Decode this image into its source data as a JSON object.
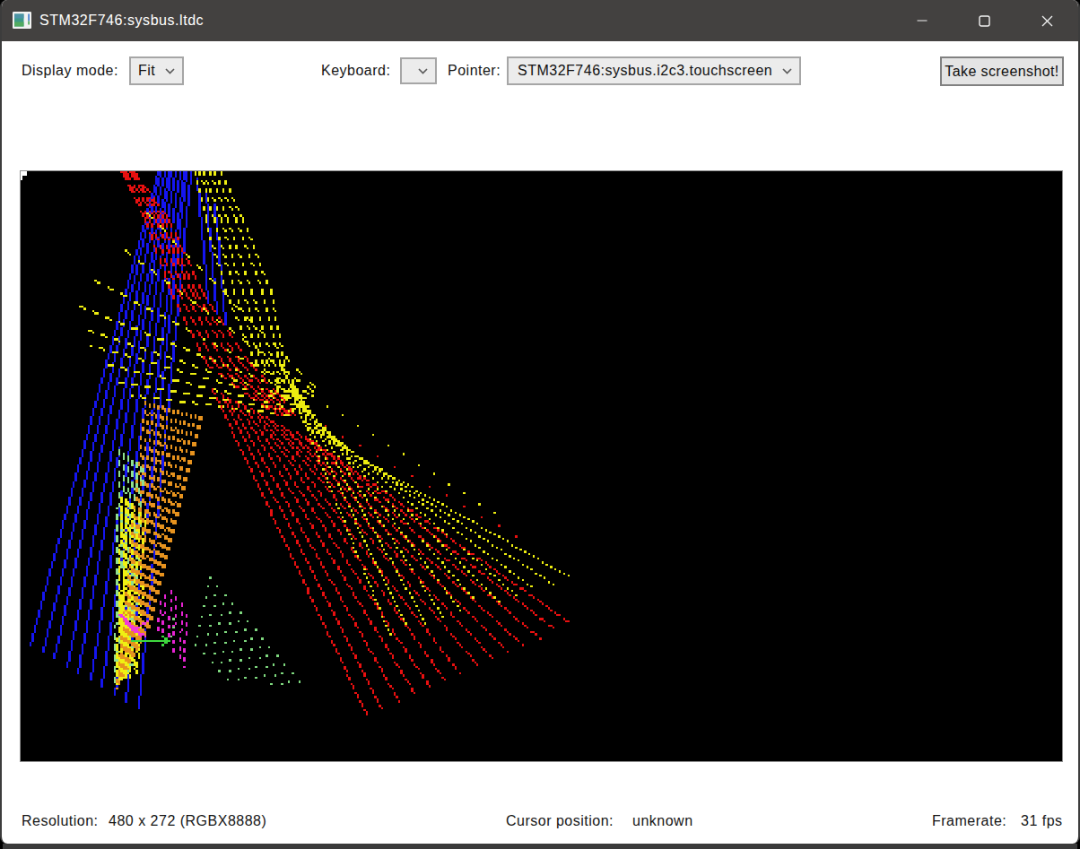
{
  "window": {
    "title": "STM32F746:sysbus.ltdc",
    "controls": {
      "minimize": "minimize",
      "maximize": "maximize",
      "close": "close"
    }
  },
  "toolbar": {
    "display_mode_label": "Display mode:",
    "display_mode_value": "Fit",
    "keyboard_label": "Keyboard:",
    "keyboard_value": "",
    "pointer_label": "Pointer:",
    "pointer_value": "STM32F746:sysbus.i2c3.touchscreen",
    "screenshot_button": "Take screenshot!"
  },
  "status_bar": {
    "resolution_label": "Resolution:",
    "resolution_value": "480 x 272 (RGBX8888)",
    "cursor_label": "Cursor position:",
    "cursor_value": "unknown",
    "framerate_label": "Framerate:",
    "framerate_value": "31 fps"
  },
  "colors": {
    "titlebar": "#434140",
    "titlebar_text": "#ffffff",
    "body": "#ffffff",
    "combo_fill": "#ececec",
    "combo_border": "#a6a6a6",
    "button_fill": "#e4e4e4",
    "button_border": "#818181",
    "framebuffer_border": "#8e8e8e",
    "outside": "#000000",
    "bottom_strip": "#3a3a3a"
  },
  "framebuffer": {
    "logical_width": 480,
    "logical_height": 272,
    "background": "#000000",
    "groups": [
      {
        "name": "blue-fan",
        "color": "#1515f0",
        "dash": [
          1,
          0
        ],
        "lines": [
          [
            62.5,
            0.0,
            4.0,
            218.0
          ],
          [
            64.2,
            0.0,
            9.6,
            221.2
          ],
          [
            65.9,
            0.0,
            15.1,
            224.4
          ],
          [
            67.7,
            0.0,
            20.7,
            227.7
          ],
          [
            69.4,
            0.0,
            26.2,
            230.9
          ],
          [
            71.1,
            0.0,
            31.8,
            234.1
          ],
          [
            72.8,
            0.0,
            37.3,
            237.3
          ],
          [
            74.6,
            0.0,
            42.9,
            240.6
          ],
          [
            76.3,
            0.0,
            48.4,
            243.8
          ],
          [
            78.0,
            0.0,
            54.0,
            247.0
          ],
          [
            80.5,
            3,
            85.5,
            60
          ],
          [
            84.5,
            9,
            89.5,
            65
          ],
          [
            88.5,
            15,
            93.5,
            70
          ]
        ]
      },
      {
        "name": "pale-green-column",
        "color": "#8fe08f",
        "dash": [
          3,
          2
        ],
        "lines": [
          [
            45.0,
            128.0,
            43.0,
            236.0
          ],
          [
            46.9,
            129.5,
            44.4,
            234.5
          ],
          [
            48.8,
            131.0,
            45.8,
            233.0
          ],
          [
            50.7,
            132.5,
            47.2,
            231.5
          ],
          [
            52.6,
            134.0,
            48.6,
            230.0
          ],
          [
            54.5,
            135.5,
            50.0,
            228.5
          ],
          [
            56.4,
            137.0,
            51.4,
            227.0
          ]
        ]
      },
      {
        "name": "bright-yellow-column",
        "color": "#f0f012",
        "dash": [
          3,
          1
        ],
        "lines": [
          [
            46.0,
            150.0,
            44.0,
            236.0
          ],
          [
            47.6,
            151.0,
            45.1,
            235.0
          ],
          [
            49.1,
            152.0,
            46.1,
            234.0
          ],
          [
            50.7,
            153.0,
            47.2,
            233.0
          ],
          [
            52.3,
            154.0,
            48.3,
            232.0
          ],
          [
            53.9,
            155.0,
            49.4,
            231.0
          ],
          [
            55.4,
            156.0,
            50.4,
            230.0
          ],
          [
            57.0,
            157.0,
            51.5,
            229.0
          ],
          [
            47.0,
            185.0,
            45.0,
            236.0
          ],
          [
            50.0,
            186.7,
            47.5,
            234.3
          ],
          [
            53.0,
            188.3,
            50.0,
            232.7
          ],
          [
            56.0,
            190.0,
            52.5,
            231.0
          ]
        ]
      },
      {
        "name": "orange-column",
        "color": "#e6921e",
        "dash": [
          2,
          2
        ],
        "lines": [
          [
            57.0,
            106.0,
            44.0,
            238.0
          ],
          [
            58.9,
            106.5,
            45.0,
            236.1
          ],
          [
            60.8,
            107.0,
            46.0,
            234.2
          ],
          [
            62.7,
            107.5,
            47.0,
            232.3
          ],
          [
            64.5,
            108.1,
            47.9,
            230.5
          ],
          [
            66.4,
            108.6,
            48.9,
            228.6
          ],
          [
            68.3,
            109.1,
            49.9,
            226.7
          ],
          [
            70.2,
            109.6,
            50.9,
            224.8
          ],
          [
            72.1,
            110.1,
            51.9,
            222.9
          ],
          [
            74.0,
            110.6,
            52.9,
            221.0
          ],
          [
            75.9,
            111.1,
            53.9,
            219.1
          ],
          [
            77.7,
            111.7,
            54.8,
            217.3
          ],
          [
            79.6,
            112.2,
            55.8,
            215.4
          ],
          [
            81.5,
            112.7,
            56.8,
            213.5
          ],
          [
            83.4,
            113.2,
            57.8,
            211.6
          ]
        ]
      },
      {
        "name": "green-dot-fan",
        "color": "#7ed87e",
        "dash": [
          1,
          3
        ],
        "lines": [
          [
            80.0,
            218.0,
            97.0,
            236.0
          ],
          [
            81.0,
            213.6,
            101.6,
            236.0
          ],
          [
            82.0,
            209.1,
            106.1,
            236.0
          ],
          [
            83.0,
            204.7,
            110.7,
            236.0
          ],
          [
            84.0,
            200.3,
            115.3,
            236.0
          ],
          [
            85.0,
            195.9,
            119.9,
            236.0
          ],
          [
            86.0,
            191.4,
            124.4,
            236.0
          ],
          [
            87.0,
            187.0,
            129.0,
            236.0
          ],
          [
            69.5,
            206,
            68.8,
            215
          ]
        ]
      },
      {
        "name": "green-arrow",
        "color": "#3ed83e",
        "dash": [
          1,
          0
        ],
        "lines": [
          [
            51,
            216,
            67.5,
            216
          ],
          [
            64.5,
            213.8,
            67.5,
            216
          ],
          [
            64.5,
            218.2,
            67.5,
            216
          ]
        ]
      },
      {
        "name": "magenta-dashes",
        "color": "#e622d2",
        "dash": [
          2,
          2
        ],
        "lines": [
          [
            63.5,
            198,
            62.5,
            211
          ],
          [
            66,
            195,
            65,
            212
          ],
          [
            68.5,
            193,
            67.5,
            216
          ],
          [
            71,
            196,
            70,
            221
          ],
          [
            73.5,
            199,
            72.5,
            225
          ],
          [
            76,
            204,
            75,
            228
          ]
        ]
      },
      {
        "name": "magenta-knot",
        "color": "#f03ad8",
        "dash": [
          1,
          0
        ],
        "lines": [
          [
            44.5,
            204,
            51.5,
            210.5
          ],
          [
            45.5,
            204,
            52.5,
            210.5
          ],
          [
            51.5,
            210.5,
            58,
            207
          ],
          [
            51.5,
            210.5,
            57,
            213.5
          ],
          [
            48,
            208,
            53.5,
            212.5
          ],
          [
            49,
            209,
            54.5,
            213.5
          ]
        ]
      },
      {
        "name": "yellow-band",
        "color": "#ecec10",
        "dash": [
          2,
          2
        ],
        "lines": [
          [
            79.5,
            0,
            85.0,
            22
          ],
          [
            85.0,
            22,
            93.7,
            55
          ],
          [
            93.7,
            55,
            107.9,
            88
          ],
          [
            107.9,
            88,
            120.4,
            103
          ],
          [
            120.4,
            103,
            127.6,
            110
          ],
          [
            81.9,
            0,
            88.5,
            22
          ],
          [
            88.5,
            22,
            97.9,
            55
          ],
          [
            97.9,
            55,
            110.5,
            88
          ],
          [
            110.5,
            88,
            121.8,
            103
          ],
          [
            121.8,
            103,
            128.6,
            110
          ],
          [
            84.3,
            0,
            92.0,
            22
          ],
          [
            92.0,
            22,
            102.1,
            55
          ],
          [
            102.1,
            55,
            113.2,
            88
          ],
          [
            113.2,
            88,
            123.3,
            103
          ],
          [
            123.3,
            103,
            129.5,
            110
          ],
          [
            86.7,
            0,
            95.4,
            22
          ],
          [
            95.4,
            22,
            106.3,
            55
          ],
          [
            106.3,
            55,
            115.8,
            88
          ],
          [
            115.8,
            88,
            124.7,
            103
          ],
          [
            124.7,
            103,
            130.5,
            110
          ],
          [
            89.1,
            0,
            98.9,
            22
          ],
          [
            98.9,
            22,
            110.5,
            55
          ],
          [
            110.5,
            55,
            118.5,
            88
          ],
          [
            118.5,
            88,
            126.2,
            103
          ],
          [
            126.2,
            103,
            131.4,
            110
          ],
          [
            91.5,
            0,
            102.4,
            22
          ],
          [
            102.4,
            22,
            114.7,
            55
          ],
          [
            114.7,
            55,
            121.1,
            88
          ],
          [
            121.1,
            88,
            127.6,
            103
          ],
          [
            127.6,
            103,
            132.4,
            110
          ]
        ]
      },
      {
        "name": "yellow-left-fan",
        "color": "#ecec10",
        "dash": [
          3,
          3
        ],
        "lines": [
          [
            135.0,
            99.0,
            57,
            18
          ],
          [
            133.5,
            100.6,
            45,
            34
          ],
          [
            132.0,
            102.2,
            34,
            50
          ],
          [
            130.5,
            103.9,
            27,
            62
          ],
          [
            129.0,
            105.5,
            28,
            72
          ],
          [
            127.5,
            107.1,
            32,
            80
          ],
          [
            126.0,
            108.8,
            37,
            88
          ],
          [
            124.5,
            110.4,
            44,
            97
          ],
          [
            123.0,
            112.0,
            51,
            103
          ]
        ]
      },
      {
        "name": "yellow-right-fan",
        "color": "#ecec10",
        "dash": [
          1,
          1
        ],
        "lines": [
          [
            118.0,
            85.0,
            170.0,
            214.0
          ],
          [
            119.4,
            88.3,
            178.3,
            211.3
          ],
          [
            120.8,
            91.6,
            186.6,
            208.6
          ],
          [
            122.2,
            94.9,
            194.9,
            205.9
          ],
          [
            123.6,
            98.2,
            203.2,
            203.2
          ],
          [
            125.0,
            101.5,
            211.5,
            200.5
          ],
          [
            126.4,
            104.8,
            219.8,
            197.8
          ],
          [
            127.8,
            108.1,
            228.1,
            195.1
          ],
          [
            129.2,
            111.4,
            236.4,
            192.4
          ],
          [
            130.6,
            114.7,
            244.7,
            189.7
          ],
          [
            132.0,
            118.0,
            253.0,
            187.0
          ]
        ]
      },
      {
        "name": "yellow-sparse",
        "color": "#ecec10",
        "dash": [
          1,
          6
        ],
        "lines": [
          [
            134,
            103,
            218,
            157
          ]
        ]
      },
      {
        "name": "red-band",
        "color": "#e81010",
        "dash": [
          4,
          2
        ],
        "lines": [
          [
            45.8,
            0,
            57.0,
            22
          ],
          [
            57.0,
            22,
            69.1,
            55
          ],
          [
            69.1,
            55,
            85.0,
            88
          ],
          [
            85.0,
            88,
            104.8,
            103
          ],
          [
            104.8,
            103,
            118.0,
            112
          ],
          [
            47.1,
            0,
            59.2,
            22
          ],
          [
            59.2,
            22,
            71.9,
            55
          ],
          [
            71.9,
            55,
            89.0,
            88
          ],
          [
            89.0,
            88,
            107.7,
            103
          ],
          [
            107.7,
            103,
            119.6,
            112
          ],
          [
            48.4,
            0,
            61.5,
            22
          ],
          [
            61.5,
            22,
            74.7,
            55
          ],
          [
            74.7,
            55,
            93.0,
            88
          ],
          [
            93.0,
            88,
            110.6,
            103
          ],
          [
            110.6,
            103,
            121.2,
            112
          ],
          [
            49.6,
            0,
            63.7,
            22
          ],
          [
            63.7,
            22,
            77.5,
            55
          ],
          [
            77.5,
            55,
            97.0,
            88
          ],
          [
            97.0,
            88,
            113.4,
            103
          ],
          [
            113.4,
            103,
            122.8,
            112
          ],
          [
            50.9,
            0,
            66.0,
            22
          ],
          [
            66.0,
            22,
            80.3,
            55
          ],
          [
            80.3,
            55,
            101.0,
            88
          ],
          [
            101.0,
            88,
            116.3,
            103
          ],
          [
            116.3,
            103,
            124.4,
            112
          ],
          [
            52.2,
            0,
            68.2,
            22
          ],
          [
            68.2,
            22,
            83.1,
            55
          ],
          [
            83.1,
            55,
            105.0,
            88
          ],
          [
            105.0,
            88,
            119.2,
            103
          ],
          [
            119.2,
            103,
            126.0,
            112
          ]
        ]
      },
      {
        "name": "red-fan",
        "color": "#e81010",
        "dash": [
          3,
          1
        ],
        "lines": [
          [
            88.0,
            100.0,
            159.0,
            250.0
          ],
          [
            91.5,
            101.8,
            166.2,
            246.8
          ],
          [
            95.1,
            103.7,
            173.5,
            243.5
          ],
          [
            98.6,
            105.5,
            180.7,
            240.3
          ],
          [
            102.2,
            107.4,
            187.9,
            237.1
          ],
          [
            105.7,
            109.2,
            195.2,
            233.8
          ],
          [
            109.2,
            111.1,
            202.4,
            230.6
          ],
          [
            112.8,
            112.9,
            209.6,
            227.4
          ],
          [
            116.3,
            114.8,
            216.8,
            224.2
          ],
          [
            119.8,
            116.6,
            224.1,
            220.9
          ],
          [
            123.4,
            118.5,
            231.3,
            217.7
          ],
          [
            126.9,
            120.3,
            238.5,
            214.5
          ],
          [
            130.5,
            122.2,
            245.8,
            211.2
          ],
          [
            134.0,
            124.0,
            253.0,
            208.0
          ]
        ]
      },
      {
        "name": "red-sparse",
        "color": "#e81010",
        "dash": [
          1,
          7
        ],
        "lines": [
          [
            140,
            117,
            228,
            168
          ]
        ]
      }
    ],
    "rects": [
      {
        "name": "white-corner-mark",
        "color": "#ffffff",
        "xywh": [
          0,
          0,
          3,
          2
        ]
      },
      {
        "name": "white-corner-mark2",
        "color": "#ffffff",
        "xywh": [
          0,
          2,
          1,
          2
        ]
      }
    ]
  }
}
